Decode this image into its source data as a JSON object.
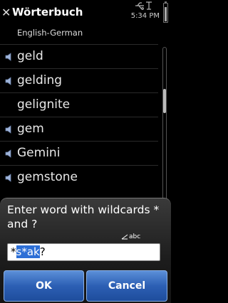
{
  "header": {
    "title": "Wörterbuch",
    "close_glyph": "✕",
    "clock": "5:34 PM",
    "subtitle": "English-German"
  },
  "word_list": [
    {
      "word": "geld",
      "has_audio": true
    },
    {
      "word": "gelding",
      "has_audio": true
    },
    {
      "word": "gelignite",
      "has_audio": false
    },
    {
      "word": "gem",
      "has_audio": true
    },
    {
      "word": "Gemini",
      "has_audio": true
    },
    {
      "word": "gemstone",
      "has_audio": true
    }
  ],
  "dialog": {
    "prompt": "Enter word with wildcards * and ?",
    "input_mode": "abc",
    "input_value": "*s*ak?",
    "ok_label": "OK",
    "cancel_label": "Cancel"
  },
  "colors": {
    "background": "#000000",
    "button": "#2c5fb4",
    "selection": "#2d6fd6"
  }
}
